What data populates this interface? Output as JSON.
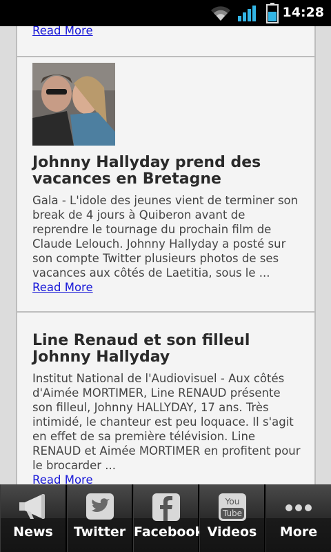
{
  "status_bar": {
    "time": "14:28"
  },
  "articles": [
    {
      "read_more": "Read More"
    },
    {
      "headline": "Johnny Hallyday prend des vacances en Bretagne",
      "summary": "Gala - L'idole des jeunes vient de terminer son break de 4 jours à Quiberon avant de reprendre le tournage du prochain film de Claude Lelouch. Johnny Hallyday a posté sur son compte Twitter plusieurs photos de ses vacances aux côtés de Laetitia, sous le ...",
      "read_more": "Read More"
    },
    {
      "headline": "Line Renaud et son filleul Johnny Hallyday",
      "summary": "Institut National de l'Audiovisuel - Aux côtés d'Aimée MORTIMER, Line RENAUD présente son filleul, Johnny HALLYDAY, 17 ans. Très intimidé, le chanteur est peu loquace. Il s'agit en effet de sa première télévision. Line RENAUD et Aimée MORTIMER en profitent pour le brocarder ...",
      "read_more": "Read More"
    }
  ],
  "tabs": [
    {
      "label": "News",
      "icon": "megaphone-icon"
    },
    {
      "label": "Twitter",
      "icon": "twitter-bird-icon"
    },
    {
      "label": "Facebook",
      "icon": "facebook-icon"
    },
    {
      "label": "Videos",
      "icon": "youtube-icon",
      "icon_text_top": "You",
      "icon_text_bottom": "Tube"
    },
    {
      "label": "More",
      "icon": "more-dots-icon"
    }
  ]
}
